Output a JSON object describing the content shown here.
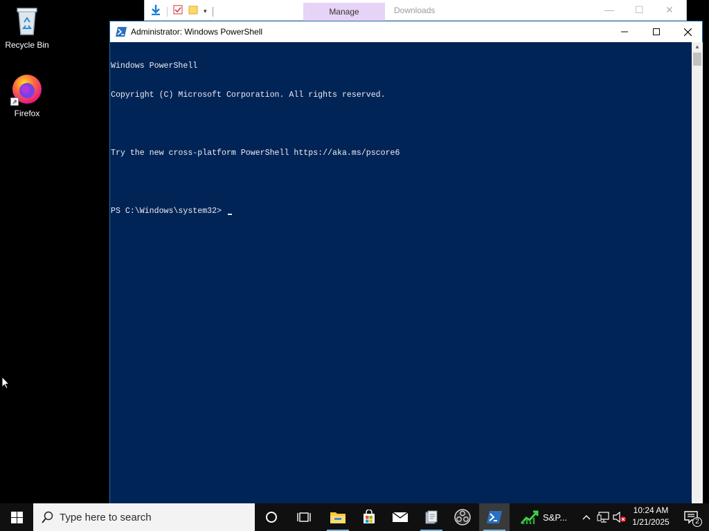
{
  "desktop": {
    "icons": [
      {
        "label": "Recycle Bin",
        "icon": "recycle-bin-icon"
      },
      {
        "label": "Firefox",
        "icon": "firefox-icon"
      }
    ]
  },
  "explorer": {
    "tab_manage": "Manage",
    "title": "Downloads"
  },
  "powershell": {
    "title": "Administrator: Windows PowerShell",
    "console_lines": [
      "Windows PowerShell",
      "Copyright (C) Microsoft Corporation. All rights reserved.",
      "",
      "Try the new cross-platform PowerShell https://aka.ms/pscore6",
      "",
      "PS C:\\Windows\\system32> "
    ],
    "colors": {
      "console_bg": "#012456",
      "console_fg": "#eeedf0"
    }
  },
  "taskbar": {
    "search_placeholder": "Type here to search",
    "pinned": [
      "task-view-icon",
      "file-explorer-icon",
      "store-icon",
      "mail-icon",
      "file-manager-icon",
      "obs-icon",
      "powershell-icon"
    ],
    "stock_label": "S&P...",
    "notification_count": "2",
    "time": "10:24 AM",
    "date": "1/21/2025"
  }
}
